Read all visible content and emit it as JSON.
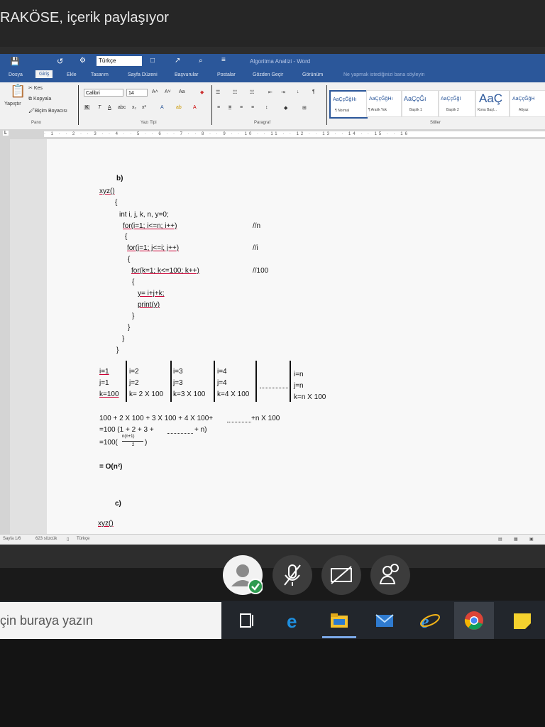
{
  "banner": {
    "text": "RAKÖSE, içerik paylaşıyor"
  },
  "word": {
    "qat": {
      "language": "Türkçe",
      "title": "Algoritma Analizi - Word"
    },
    "tabs": [
      "Dosya",
      "Giriş",
      "Ekle",
      "Tasarım",
      "Sayfa Düzeni",
      "Başvurular",
      "Postalar",
      "Gözden Geçir",
      "Görünüm",
      "Ne yapmak istediğinizi bana söyleyin"
    ],
    "clipboard": {
      "paste": "Yapıştır",
      "cut": "Kes",
      "copy": "Kopyala",
      "format_painter": "Biçim Boyacısı",
      "group": "Pano"
    },
    "font": {
      "name": "Calibri",
      "size": "14",
      "group": "Yazı Tipi"
    },
    "paragraph": {
      "group": "Paragraf"
    },
    "styles": {
      "group": "Stiller",
      "items": [
        {
          "preview": "AaÇçĞğHı",
          "name": "¶ Normal"
        },
        {
          "preview": "AaÇçĞğHı",
          "name": "¶ Aralık Yok"
        },
        {
          "preview": "AaÇçĞı",
          "name": "Başlık 1"
        },
        {
          "preview": "AaÇçĞğI",
          "name": "Başlık 2"
        },
        {
          "preview": "AaÇ",
          "name": "Konu Başl..."
        },
        {
          "preview": "AaÇçĞğH",
          "name": "Altyaz"
        }
      ]
    },
    "status": {
      "page": "Sayfa 1/6",
      "words": "623 sözcük",
      "language": "Türkçe"
    }
  },
  "doc": {
    "b_label": "b)",
    "func1": "xyz()",
    "brace_open": "{",
    "decl": "int i, j, k, n, y=0;",
    "for1": "for(i=1; i<=n; i++)",
    "c1": "//n",
    "b1": "{",
    "for2": "for(j=1; j<=i; j++)",
    "c2": "//i",
    "b2": "{",
    "for3": "for(k=1; k<=100; k++)",
    "c3": "//100",
    "b3": "{",
    "stmt": "y= i+j+k;",
    "print": "print(y)",
    "cb1": "}",
    "cb2": "}",
    "cb3": "}",
    "cb4": "}",
    "table": [
      [
        "i=1",
        "j=1",
        "k=100"
      ],
      [
        "i=2",
        "j=2",
        "k= 2 X 100"
      ],
      [
        "i=3",
        "j=3",
        "k=3 X 100"
      ],
      [
        "i=4",
        "j=4",
        "k=4 X 100"
      ],
      [
        "",
        "",
        ""
      ],
      [
        "i=n",
        "j=n",
        "k=n X 100"
      ]
    ],
    "sum1": "100 + 2 X 100 + 3 X 100 + 4 X 100+",
    "sum1b": "+n X 100",
    "sum2": "=100 (1 + 2 + 3 +",
    "sum2b": "+ n)",
    "sum3": "=100(",
    "frac_num": "n(n+1)",
    "frac_den": "2",
    "sum3b": ")",
    "result": "= O(n²)",
    "c_label": "c)",
    "func2": "xyz()"
  },
  "taskbar": {
    "search_placeholder": "çin buraya yazın"
  }
}
